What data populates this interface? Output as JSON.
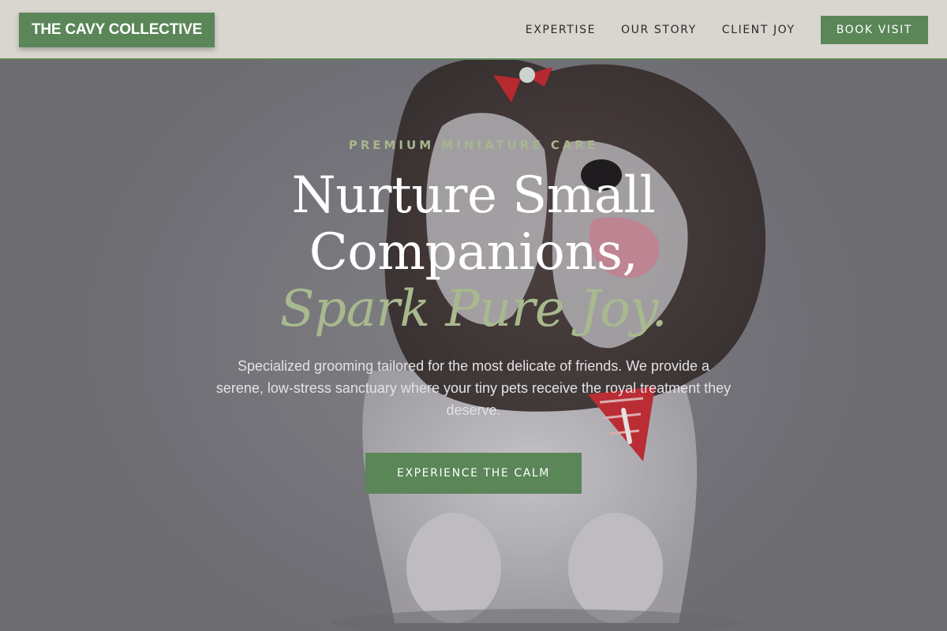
{
  "nav": {
    "brand": "THE CAVY COLLECTIVE",
    "links": [
      "EXPERTISE",
      "OUR STORY",
      "CLIENT JOY"
    ],
    "book_label": "BOOK VISIT"
  },
  "hero": {
    "eyebrow": "PREMIUM MINIATURE CARE",
    "headline_line1": "Nurture Small",
    "headline_line2": "Companions,",
    "headline_accent": "Spark Pure Joy.",
    "description": "Specialized grooming tailored for the most delicate of friends. We provide a serene, low-stress sanctuary where your tiny pets receive the royal treatment they deserve.",
    "cta_label": "EXPERIENCE THE CALM",
    "image_subject": "fluffy-dog-with-red-bow-and-bandana"
  },
  "colors": {
    "accent_green": "#5a8658",
    "sage": "#a8b98e",
    "nav_bg": "#dedbd4"
  }
}
